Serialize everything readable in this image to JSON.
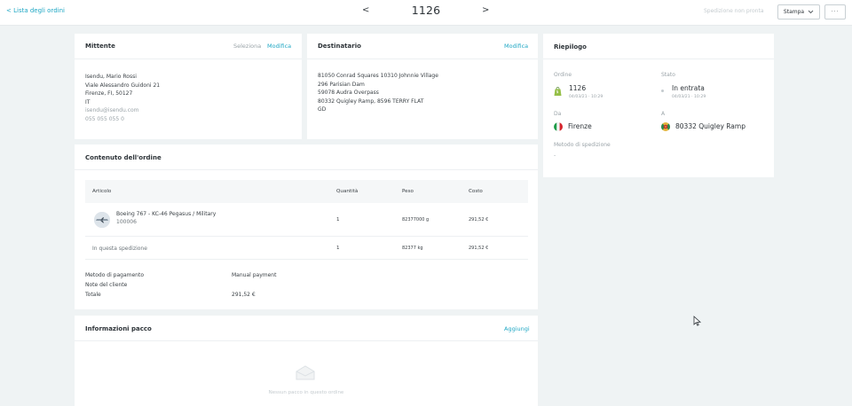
{
  "topbar": {
    "back_label": "Lista degli ordini",
    "prev": "<",
    "order_number": "1126",
    "next": ">",
    "shipping_status": "Spedizione non pronta",
    "print_label": "Stampa",
    "more": "···"
  },
  "sender": {
    "title": "Mittente",
    "select": "Seleziona",
    "edit": "Modifica",
    "lines": [
      "Isendu, Mario Rossi",
      "Viale Alessandro Guidoni 21",
      "Firenze, FI, 50127",
      "IT"
    ],
    "email": "isendu@isendu.com",
    "phone": "055 055 055 0"
  },
  "recipient": {
    "title": "Destinatario",
    "edit": "Modifica",
    "lines": [
      "81050 Conrad Squares 10310 Johnnie Village",
      "296 Parisian Dam",
      "59078 Audra Overpass",
      "80332 Quigley Ramp, 8596 TERRY FLAT",
      "GD"
    ]
  },
  "contents": {
    "title": "Contenuto dell'ordine",
    "headers": {
      "article": "Articolo",
      "qty": "Quantità",
      "weight": "Peso",
      "cost": "Costo"
    },
    "item": {
      "name": "Boeing 767 - KC-46 Pegasus / Military",
      "sku": "100006",
      "qty": "1",
      "weight": "82377000 g",
      "cost": "291,52 €"
    },
    "shipment": {
      "label": "In questa spedizione",
      "qty": "1",
      "weight": "82377 kg",
      "cost": "291,52 €"
    },
    "payment_label": "Metodo di pagamento",
    "payment_value": "Manual payment",
    "notes_label": "Note del cliente",
    "total_label": "Totale",
    "total_value": "291,52 €"
  },
  "package": {
    "title": "Informazioni pacco",
    "add": "Aggiungi",
    "empty": "Nessun pacco in questo ordine"
  },
  "summary": {
    "title": "Riepilogo",
    "order_label": "Ordine",
    "order_value": "1126",
    "order_date": "04/03/21 · 10:29",
    "status_label": "Stato",
    "status_value": "In entrata",
    "status_date": "04/03/21 · 10:29",
    "from_label": "Da",
    "from_value": "Firenze",
    "to_label": "A",
    "to_value": "80332 Quigley Ramp",
    "method_label": "Metodo di spedizione",
    "method_value": "-"
  },
  "colors": {
    "accent": "#1fa7c4",
    "background": "#eff3f4",
    "shopify_green": "#95bf47"
  }
}
